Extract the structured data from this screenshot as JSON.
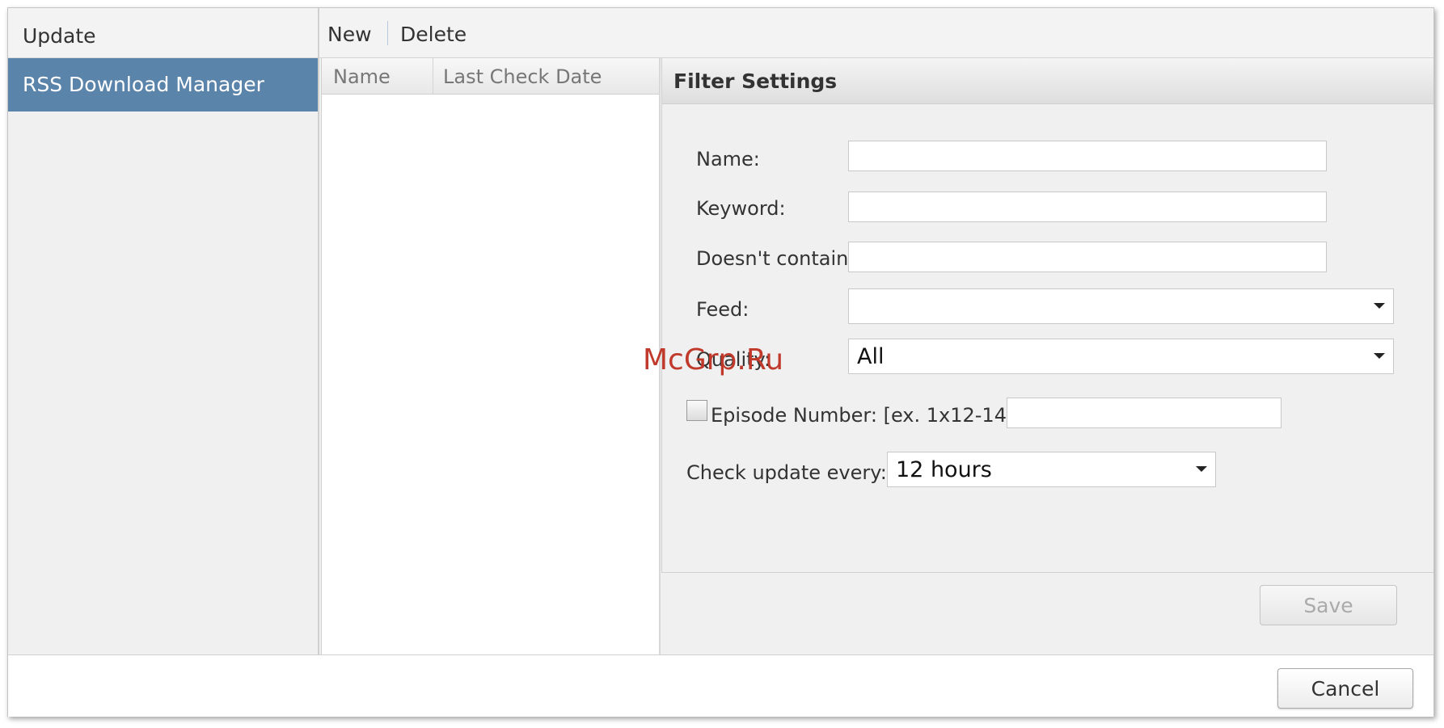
{
  "nav": {
    "header": "Update",
    "items": [
      {
        "label": "RSS Download Manager",
        "selected": true
      }
    ]
  },
  "toolbar": {
    "new_label": "New",
    "delete_label": "Delete"
  },
  "list": {
    "columns": [
      "Name",
      "Last Check Date"
    ]
  },
  "filter": {
    "title": "Filter Settings",
    "name_label": "Name:",
    "name_value": "",
    "keyword_label": "Keyword:",
    "keyword_value": "",
    "exclude_label": "Doesn't contain:",
    "exclude_value": "",
    "feed_label": "Feed:",
    "feed_value": "",
    "quality_label": "Quality:",
    "quality_value": "All",
    "episode_label": "Episode Number: [ex. 1x12-14]",
    "episode_checked": false,
    "episode_value": "",
    "check_label": "Check update every:",
    "check_value": "12 hours",
    "save_label": "Save"
  },
  "footer": {
    "cancel_label": "Cancel"
  },
  "watermark": "McGrp.Ru",
  "colors": {
    "selection": "#5b84aa",
    "watermark": "#c0392b"
  }
}
